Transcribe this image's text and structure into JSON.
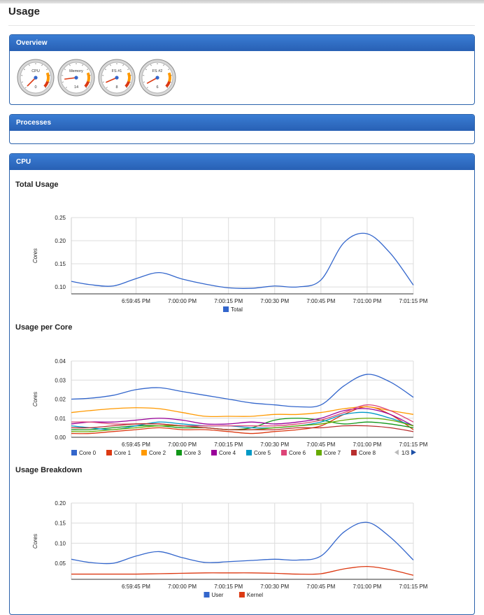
{
  "page": {
    "title": "Usage"
  },
  "panels": {
    "overview": "Overview",
    "processes": "Processes",
    "cpu": "CPU"
  },
  "gauges": [
    {
      "label": "CPU",
      "value": "0",
      "level": 0.0
    },
    {
      "label": "Memory",
      "value": "14",
      "level": 0.14
    },
    {
      "label": "FS #1",
      "value": "8",
      "level": 0.08
    },
    {
      "label": "FS #2",
      "value": "6",
      "level": 0.06
    }
  ],
  "colors": {
    "accent": "#2a64b5",
    "grid": "#dcdcdc"
  },
  "chart_data": [
    {
      "type": "line",
      "title": "Total Usage",
      "ylabel": "Cores",
      "xlabel": "",
      "x_ticks": [
        "6:59:45 PM",
        "7:00:00 PM",
        "7:00:15 PM",
        "7:00:30 PM",
        "7:00:45 PM",
        "7:01:00 PM",
        "7:01:15 PM"
      ],
      "y_ticks": [
        "0.25",
        "0.20",
        "0.15",
        "0.10"
      ],
      "ylim": [
        0.085,
        0.25
      ],
      "x": [
        -1.4,
        -1.0,
        -0.5,
        0,
        0.5,
        1.0,
        1.5,
        2.0,
        2.5,
        3.0,
        3.5,
        4.0,
        4.5,
        5.0,
        5.5,
        6.0
      ],
      "series": [
        {
          "name": "Total",
          "color": "#3366cc",
          "values": [
            0.112,
            0.105,
            0.102,
            0.118,
            0.131,
            0.117,
            0.106,
            0.098,
            0.097,
            0.102,
            0.1,
            0.115,
            0.196,
            0.215,
            0.173,
            0.104
          ]
        }
      ],
      "legend": "bottom"
    },
    {
      "type": "line",
      "title": "Usage per Core",
      "ylabel": "Cores",
      "xlabel": "",
      "x_ticks": [
        "6:59:45 PM",
        "7:00:00 PM",
        "7:00:15 PM",
        "7:00:30 PM",
        "7:00:45 PM",
        "7:01:00 PM",
        "7:01:15 PM"
      ],
      "y_ticks": [
        "0.04",
        "0.03",
        "0.02",
        "0.01",
        "0.00"
      ],
      "ylim": [
        0,
        0.04
      ],
      "x": [
        -1.4,
        -1.0,
        -0.5,
        0,
        0.5,
        1.0,
        1.5,
        2.0,
        2.5,
        3.0,
        3.5,
        4.0,
        4.5,
        5.0,
        5.5,
        6.0
      ],
      "series": [
        {
          "name": "Core 0",
          "color": "#3366cc",
          "values": [
            0.02,
            0.0205,
            0.022,
            0.025,
            0.026,
            0.024,
            0.022,
            0.02,
            0.018,
            0.017,
            0.016,
            0.017,
            0.027,
            0.033,
            0.029,
            0.021
          ]
        },
        {
          "name": "Core 1",
          "color": "#dc3912",
          "values": [
            0.002,
            0.002,
            0.003,
            0.004,
            0.005,
            0.004,
            0.004,
            0.003,
            0.002,
            0.003,
            0.004,
            0.006,
            0.012,
            0.016,
            0.012,
            0.004
          ]
        },
        {
          "name": "Core 2",
          "color": "#ff9900",
          "values": [
            0.013,
            0.014,
            0.015,
            0.0155,
            0.015,
            0.013,
            0.011,
            0.011,
            0.011,
            0.012,
            0.012,
            0.013,
            0.015,
            0.016,
            0.014,
            0.012
          ]
        },
        {
          "name": "Core 3",
          "color": "#109618",
          "values": [
            0.004,
            0.004,
            0.005,
            0.006,
            0.006,
            0.005,
            0.005,
            0.004,
            0.005,
            0.009,
            0.01,
            0.009,
            0.007,
            0.008,
            0.007,
            0.005
          ]
        },
        {
          "name": "Core 4",
          "color": "#990099",
          "values": [
            0.007,
            0.008,
            0.008,
            0.009,
            0.01,
            0.009,
            0.007,
            0.007,
            0.008,
            0.007,
            0.008,
            0.01,
            0.014,
            0.015,
            0.012,
            0.006
          ]
        },
        {
          "name": "Core 5",
          "color": "#0099c6",
          "values": [
            0.006,
            0.005,
            0.004,
            0.006,
            0.008,
            0.007,
            0.006,
            0.006,
            0.005,
            0.005,
            0.006,
            0.008,
            0.012,
            0.013,
            0.01,
            0.006
          ]
        },
        {
          "name": "Core 6",
          "color": "#dd4477",
          "values": [
            0.008,
            0.008,
            0.007,
            0.007,
            0.007,
            0.006,
            0.006,
            0.006,
            0.006,
            0.006,
            0.007,
            0.009,
            0.013,
            0.017,
            0.014,
            0.008
          ]
        },
        {
          "name": "Core 7",
          "color": "#66aa00",
          "values": [
            0.003,
            0.003,
            0.004,
            0.005,
            0.006,
            0.006,
            0.005,
            0.004,
            0.004,
            0.005,
            0.006,
            0.007,
            0.009,
            0.01,
            0.009,
            0.006
          ]
        },
        {
          "name": "Core 8",
          "color": "#b82e2e",
          "values": [
            0.005,
            0.005,
            0.006,
            0.007,
            0.007,
            0.006,
            0.005,
            0.004,
            0.004,
            0.004,
            0.005,
            0.005,
            0.006,
            0.006,
            0.005,
            0.003
          ]
        }
      ],
      "legend": "bottom",
      "legend_pager": "1/3"
    },
    {
      "type": "line",
      "title": "Usage Breakdown",
      "ylabel": "Cores",
      "xlabel": "",
      "x_ticks": [
        "6:59:45 PM",
        "7:00:00 PM",
        "7:00:15 PM",
        "7:00:30 PM",
        "7:00:45 PM",
        "7:01:00 PM",
        "7:01:15 PM"
      ],
      "y_ticks": [
        "0.20",
        "0.15",
        "0.10",
        "0.05"
      ],
      "ylim": [
        0.01,
        0.2
      ],
      "x": [
        -1.4,
        -1.0,
        -0.5,
        0,
        0.5,
        1.0,
        1.5,
        2.0,
        2.5,
        3.0,
        3.5,
        4.0,
        4.5,
        5.0,
        5.5,
        6.0
      ],
      "series": [
        {
          "name": "User",
          "color": "#3366cc",
          "values": [
            0.06,
            0.052,
            0.05,
            0.068,
            0.079,
            0.064,
            0.052,
            0.054,
            0.057,
            0.06,
            0.058,
            0.068,
            0.128,
            0.152,
            0.115,
            0.058
          ]
        },
        {
          "name": "Kernel",
          "color": "#dc3912",
          "values": [
            0.023,
            0.023,
            0.023,
            0.023,
            0.024,
            0.025,
            0.026,
            0.026,
            0.026,
            0.025,
            0.023,
            0.024,
            0.036,
            0.042,
            0.034,
            0.02
          ]
        }
      ],
      "legend": "bottom"
    }
  ]
}
